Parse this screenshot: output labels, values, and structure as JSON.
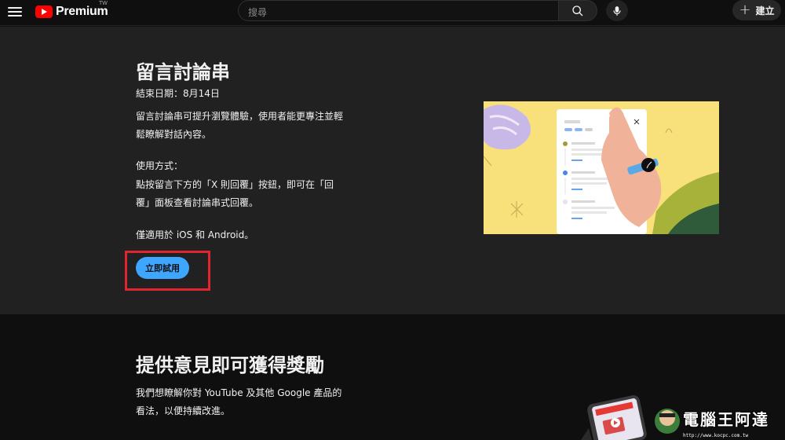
{
  "header": {
    "logo_text": "Premium",
    "logo_superscript": "TW",
    "search_placeholder": "搜尋",
    "create_label": "建立"
  },
  "feature": {
    "title": "留言討論串",
    "end_date": "結束日期：8月14日",
    "description": "留言討論串可提升瀏覽體驗，使用者能更專注並輕鬆瞭解對話內容。",
    "howto_title": "使用方式：",
    "howto": "點按留言下方的「X 則回覆」按鈕，即可在「回覆」面板查看討論串式回覆。",
    "platform": "僅適用於 iOS 和 Android。",
    "try_button": "立即試用"
  },
  "feedback": {
    "title": "提供意見即可獲得獎勵",
    "description": "我們想瞭解你對 YouTube 及其他 Google 產品的看法，以便持續改進。"
  },
  "watermark": {
    "text": "電腦王阿達",
    "url": "http://www.kocpc.com.tw"
  },
  "colors": {
    "accent": "#3ea6ff",
    "highlight": "#e1252f",
    "brand": "#ff0000",
    "illustration_bg": "#f8e07a"
  },
  "icons": [
    "menu-icon",
    "youtube-logo-icon",
    "search-icon",
    "mic-icon",
    "plus-icon"
  ]
}
